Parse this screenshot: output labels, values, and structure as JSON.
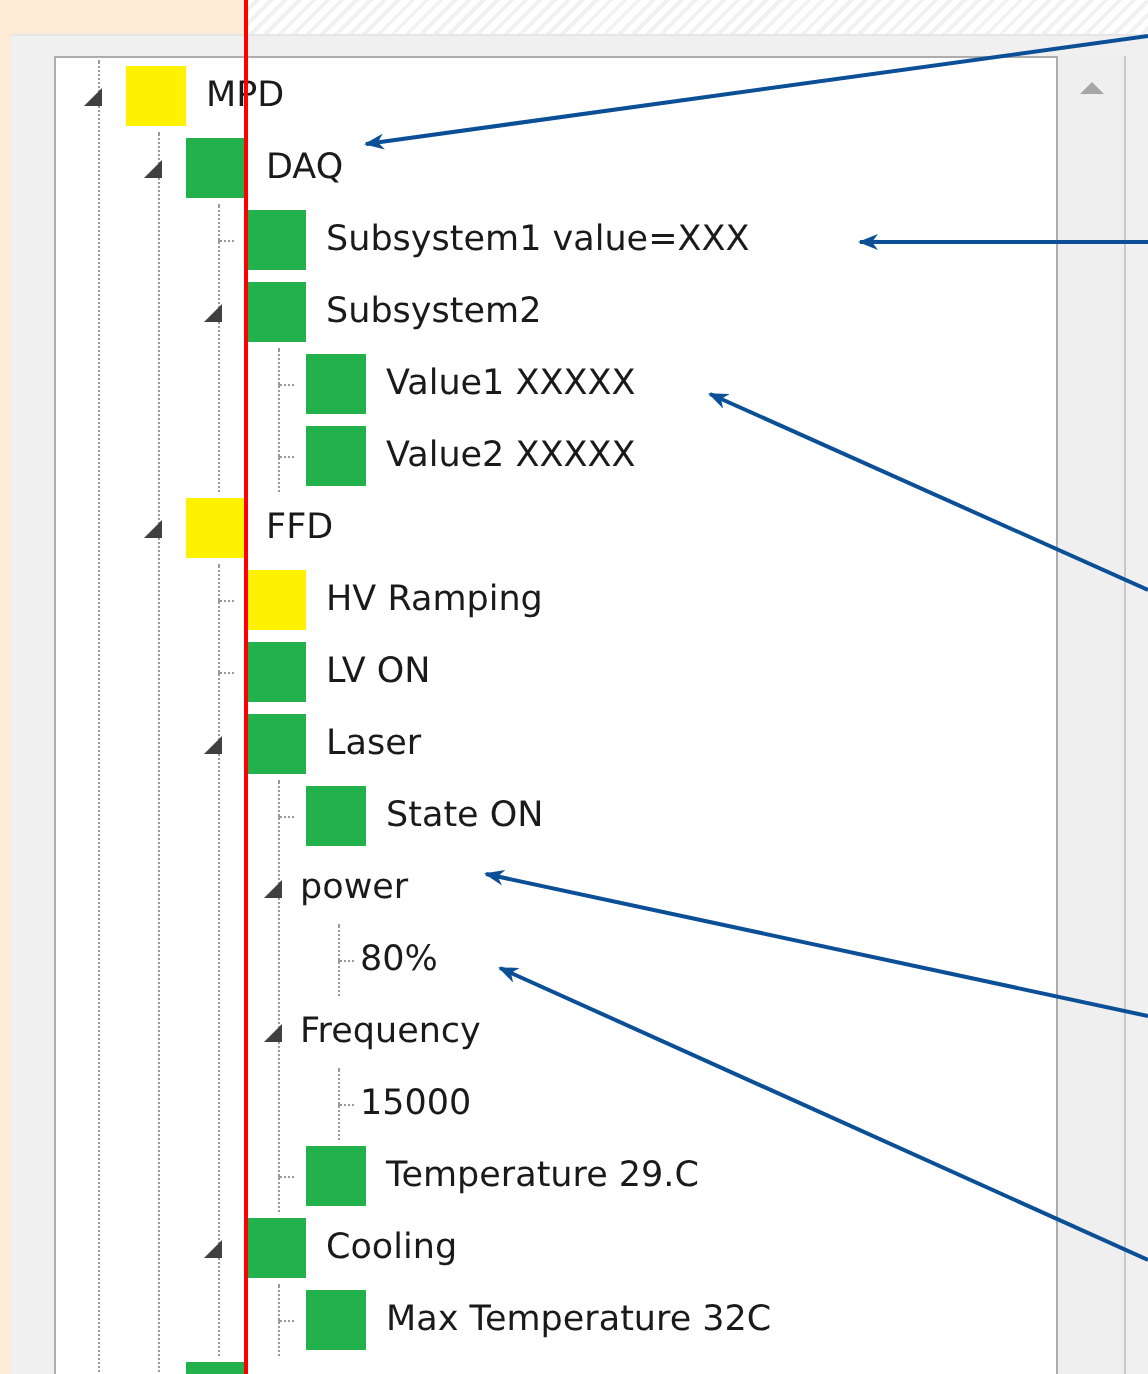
{
  "tree": [
    {
      "label": "MPD",
      "color": "#fff200",
      "expanded": true,
      "children": [
        {
          "label": "DAQ",
          "color": "#22b14c",
          "expanded": true,
          "children": [
            {
              "label": "Subsystem1 value=XXX",
              "color": "#22b14c"
            },
            {
              "label": "Subsystem2",
              "color": "#22b14c",
              "expanded": true,
              "children": [
                {
                  "label": "Value1 XXXXX",
                  "color": "#22b14c"
                },
                {
                  "label": "Value2 XXXXX",
                  "color": "#22b14c"
                }
              ]
            }
          ]
        },
        {
          "label": "FFD",
          "color": "#fff200",
          "expanded": true,
          "children": [
            {
              "label": "HV Ramping",
              "color": "#fff200"
            },
            {
              "label": "LV ON",
              "color": "#22b14c"
            },
            {
              "label": "Laser",
              "color": "#22b14c",
              "expanded": true,
              "children": [
                {
                  "label": "State ON",
                  "color": "#22b14c"
                },
                {
                  "label": "power",
                  "expanded": true,
                  "children": [
                    {
                      "label": "80%"
                    }
                  ]
                },
                {
                  "label": "Frequency",
                  "expanded": true,
                  "children": [
                    {
                      "label": "15000"
                    }
                  ]
                },
                {
                  "label": "Temperature 29.C",
                  "color": "#22b14c"
                }
              ]
            },
            {
              "label": "Cooling",
              "color": "#22b14c",
              "expanded": true,
              "children": [
                {
                  "label": "Max Temperature 32C",
                  "color": "#22b14c"
                }
              ]
            }
          ]
        },
        {
          "color": "#22b14c"
        }
      ]
    }
  ]
}
